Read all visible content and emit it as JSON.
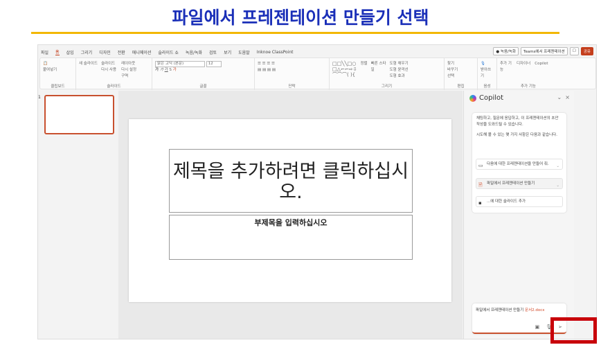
{
  "heading": "파일에서 프레젠테이션 만들기 선택",
  "tabs": [
    "파일",
    "홈",
    "삽입",
    "그리기",
    "디자인",
    "전환",
    "애니메이션",
    "슬라이드 쇼",
    "녹음/녹화",
    "검토",
    "보기",
    "도움말",
    "Inknoe ClassPoint"
  ],
  "top_buttons": {
    "record": "● 녹음/녹화",
    "teams": "Teams에서 프레젠테이션",
    "share": "공유"
  },
  "ribbon": {
    "clipboard": {
      "label": "클립보드",
      "paste": "붙여넣기"
    },
    "slides": {
      "label": "슬라이드",
      "new_slide": "새 슬라이드",
      "reuse": "슬라이드 다시 사용",
      "layout": "레이아웃",
      "reset": "다시 설정",
      "section": "구역"
    },
    "font": {
      "label": "글꼴",
      "font_name": "맑은 고딕 (본문)",
      "font_size": "12"
    },
    "paragraph": {
      "label": "단락"
    },
    "drawing": {
      "label": "그리기",
      "arrange": "정렬",
      "quick_styles": "빠른 스타일",
      "fill": "도형 채우기",
      "outline": "도형 윤곽선",
      "effects": "도형 효과"
    },
    "editing": {
      "label": "편집",
      "find": "찾기",
      "replace": "바꾸기",
      "select": "선택"
    },
    "voice": {
      "label": "음성",
      "dictate": "받아쓰기"
    },
    "addins": {
      "label": "추가 기능",
      "addins": "추가 기능",
      "designer": "디자이너",
      "copilot": "Copilot"
    }
  },
  "slide_number": "1",
  "slide": {
    "title": "제목을 추가하려면 클릭하십시오.",
    "subtitle": "부제목을 입력하십시오"
  },
  "copilot": {
    "title": "Copilot",
    "intro": "채팅하고, 질문에 응답하고, 이 프레젠테이션의 초안 작성을 도와드릴 수 있습니다.",
    "try": "시도해 볼 수 있는 몇 가지 사항은 다음과 같습니다.",
    "suggestions": [
      "다음에 대한 프레젠테이션을 만들어 줘.",
      "파일에서 프레젠테이션 만들기",
      "...에 대한 슬라이드 추가"
    ],
    "input_text": "파일에서 프레젠테이션 만들기",
    "input_file": "문서2.docx"
  },
  "colors": {
    "accent": "#c43e1c",
    "heading": "#1a2fb8",
    "highlight_box": "#c8000a"
  }
}
